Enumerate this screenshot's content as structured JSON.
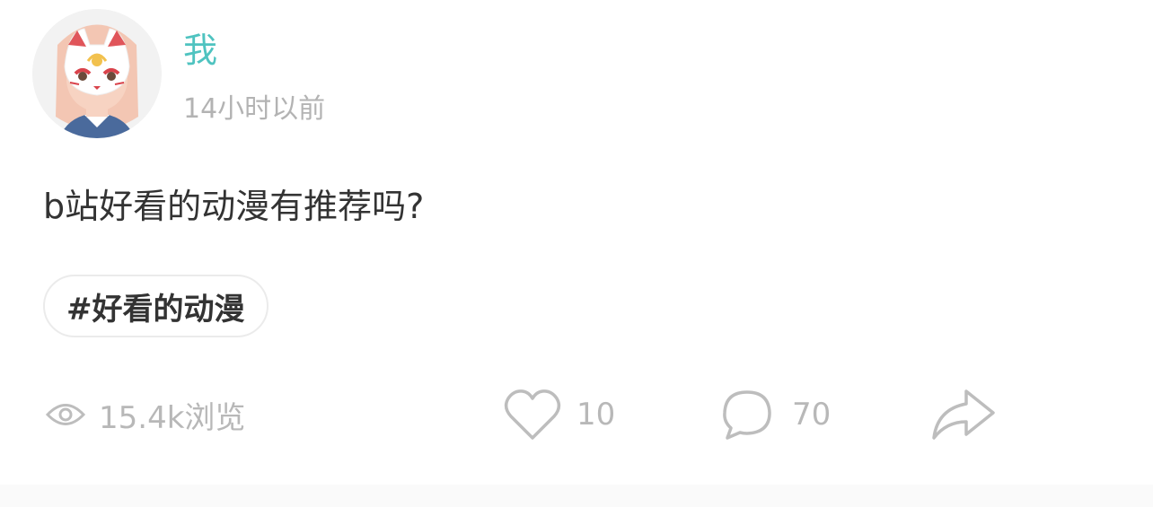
{
  "post": {
    "author": "我",
    "time": "14小时以前",
    "text": "b站好看的动漫有推荐吗?",
    "tag": "#好看的动漫"
  },
  "stats": {
    "views": "15.4k浏览",
    "likes": "10",
    "comments": "70"
  },
  "icons": {
    "views": "eye-icon",
    "likes": "heart-icon",
    "comments": "comment-bubble-icon",
    "share": "share-arrow-icon"
  },
  "colors": {
    "username": "#4fc3c0",
    "meta": "#b3b3b3",
    "text": "#333333",
    "icon": "#bdbdbd"
  }
}
